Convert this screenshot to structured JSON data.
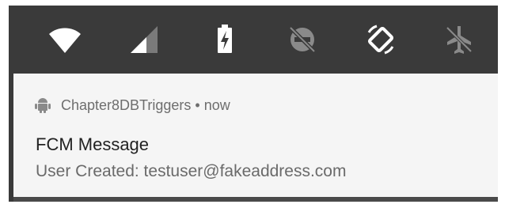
{
  "quick_settings": {
    "tiles": [
      {
        "icon": "wifi-icon",
        "state": "on"
      },
      {
        "icon": "cellular-signal-icon",
        "state": "partial"
      },
      {
        "icon": "battery-charging-icon",
        "state": "on"
      },
      {
        "icon": "do-not-disturb-off-icon",
        "state": "off"
      },
      {
        "icon": "auto-rotate-icon",
        "state": "on"
      },
      {
        "icon": "airplane-mode-icon",
        "state": "off"
      }
    ]
  },
  "notification": {
    "app_icon": "android-robot-icon",
    "app_name": "Chapter8DBTriggers",
    "separator": "•",
    "time": "now",
    "title": "FCM Message",
    "body": "User Created: testuser@fakeaddress.com"
  },
  "colors": {
    "shade_background": "#3a3a3a",
    "card_background": "#f5f5f5",
    "icon_active": "#ffffff",
    "icon_inactive": "#8a8a8a",
    "title_text": "#222222",
    "secondary_text": "#6e6e6e"
  }
}
